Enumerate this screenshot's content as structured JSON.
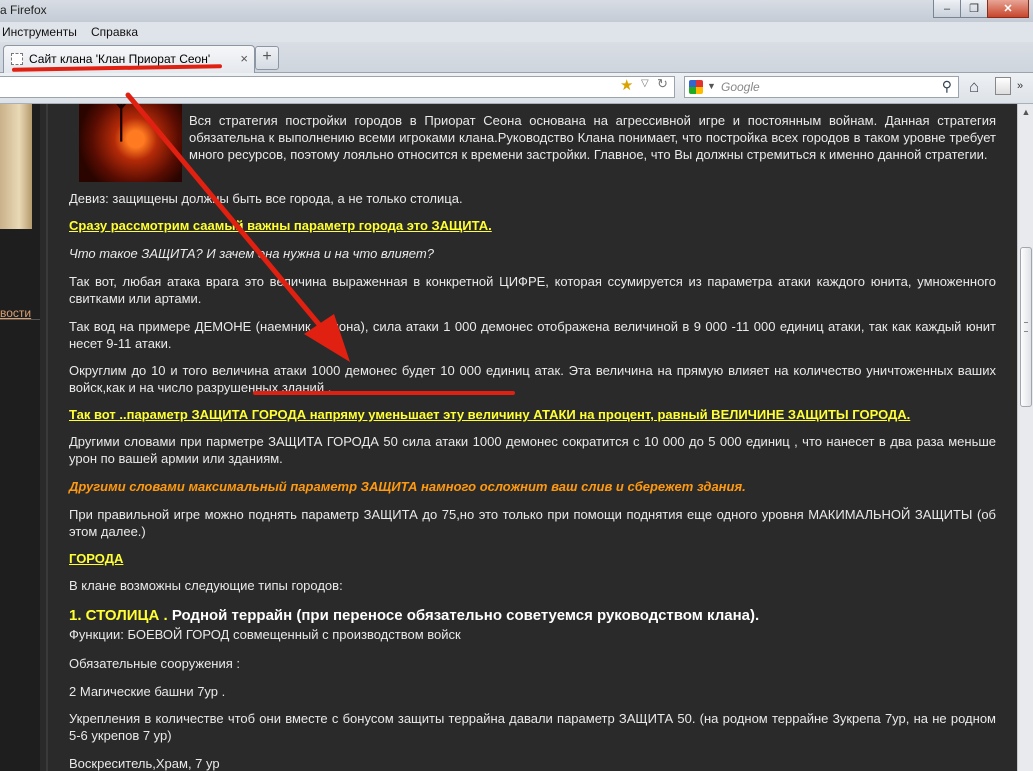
{
  "window": {
    "title": "а Firefox",
    "controls": [
      "–",
      "❐",
      "✕"
    ]
  },
  "menu": {
    "items": [
      "Инструменты",
      "Справка"
    ]
  },
  "tab": {
    "title": "Сайт клана 'Клан Приорат Сеон'",
    "close": "×",
    "new_tab": "+"
  },
  "search": {
    "placeholder": "Google"
  },
  "sidebar": {
    "link": "вости"
  },
  "content": {
    "intro": "Вся стратегия постройки городов в Приорат Сеона  основана на агрессивной игре и постоянным войнам. Данная стратегия обязательна к выполнению всеми игроками клана.Руководство Клана понимает, что постройка всех городов в таком уровне требует много ресурсов, поэтому лояльно относится к времени застройки. Главное, что Вы должны стремиться к именно данной стратегии.",
    "motto": "Девиз: защищены должны быть все города, а не только столица.",
    "heading_defense": "Сразу рассмотрим саамый важны параметр города это ЗАЩИТА.",
    "question": "Что такое ЗАЩИТА? И зачем она нужна и на что влияет?",
    "p1": "Так вот, любая атака врага это величина выраженная в конкретной ЦИФРЕ, которая ссумируется из параметра атаки каждого юнита, умноженного свитками или артами.",
    "p2": "Так вод на примере  ДЕМОНЕ (наемник демона), сила атаки  1 000 демонес  отображена  величиной в 9 000 -11 000 единиц атаки, так как каждый юнит несет 9-11 атаки.",
    "p3": "Округлим   до 10 и того величина атаки 1000 демонес будет     10 000 единиц атак. Эта величина на прямую влияет на количество уничтоженных ваших войск,как и на число разрушенных зданий .",
    "heading_param": "Так вот ..параметр ЗАЩИТА ГОРОДА  напряму уменьшает эту величину АТАКИ на процент, равный ВЕЛИЧИНЕ ЗАЩИТЫ ГОРОДА.",
    "p4": "Другими словами при парметре ЗАЩИТА ГОРОДА 50 сила атаки 1000 демонес сократится с 10 000 до 5 000 единиц , что нанесет в два раза меньше урон по вашей армии или зданиям.",
    "orange": "Другими словами максимальный параметр ЗАЩИТА  намного осложнит ваш слив и сбережет здания.",
    "p5": "При правильной игре можно поднять параметр ЗАЩИТА   до 75,но это только при помощи поднятия еще одного уровня МАКИМАЛЬНОЙ ЗАЩИТЫ (об этом далее.)",
    "heading_cities": "ГОРОДА ",
    "p6": "В клане возможны следующие типы городов:",
    "city1_num": "1.  СТОЛИЦА .",
    "city1_rest": "  Родной террайн  (при переносе обязательно советуемся руководством клана).",
    "functions": "Функции: БОЕВОЙ ГОРОД совмещенный с производством войск",
    "required": "Обязательные сооружения :",
    "towers": "2 Магические башни 7ур .",
    "fort": "Укрепления в количестве чтоб они вместе с бонусом защиты террайна давали параметр ЗАЩИТА  50.  (на родном террайне 3укрепа 7ур, на не родном 5-6 укрепов 7 ур)",
    "resurrect": "Воскреситель,Храм, 7 ур"
  }
}
